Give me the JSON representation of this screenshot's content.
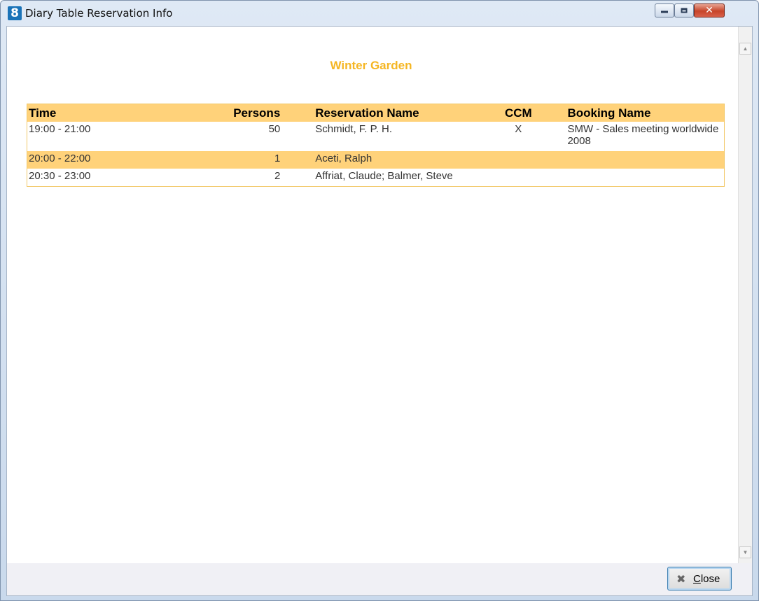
{
  "window": {
    "title": "Diary Table Reservation Info",
    "app_icon": "8"
  },
  "heading": "Winter Garden",
  "table": {
    "headers": [
      "Time",
      "Persons",
      "Reservation Name",
      "CCM",
      "Booking Name"
    ],
    "rows": [
      {
        "time": "19:00 - 21:00",
        "persons": "50",
        "reservation_name": "Schmidt, F. P. H.",
        "ccm": "X",
        "booking_name": "SMW - Sales meeting worldwide 2008"
      },
      {
        "time": "20:00 - 22:00",
        "persons": "1",
        "reservation_name": "Aceti, Ralph",
        "ccm": "",
        "booking_name": ""
      },
      {
        "time": "20:30 - 23:00",
        "persons": "2",
        "reservation_name": "Affriat, Claude; Balmer, Steve",
        "ccm": "",
        "booking_name": ""
      }
    ]
  },
  "footer": {
    "close_label_underlined": "C",
    "close_label_rest": "lose"
  },
  "colors": {
    "accent": "#f5b623",
    "row_highlight": "#ffd27a"
  }
}
